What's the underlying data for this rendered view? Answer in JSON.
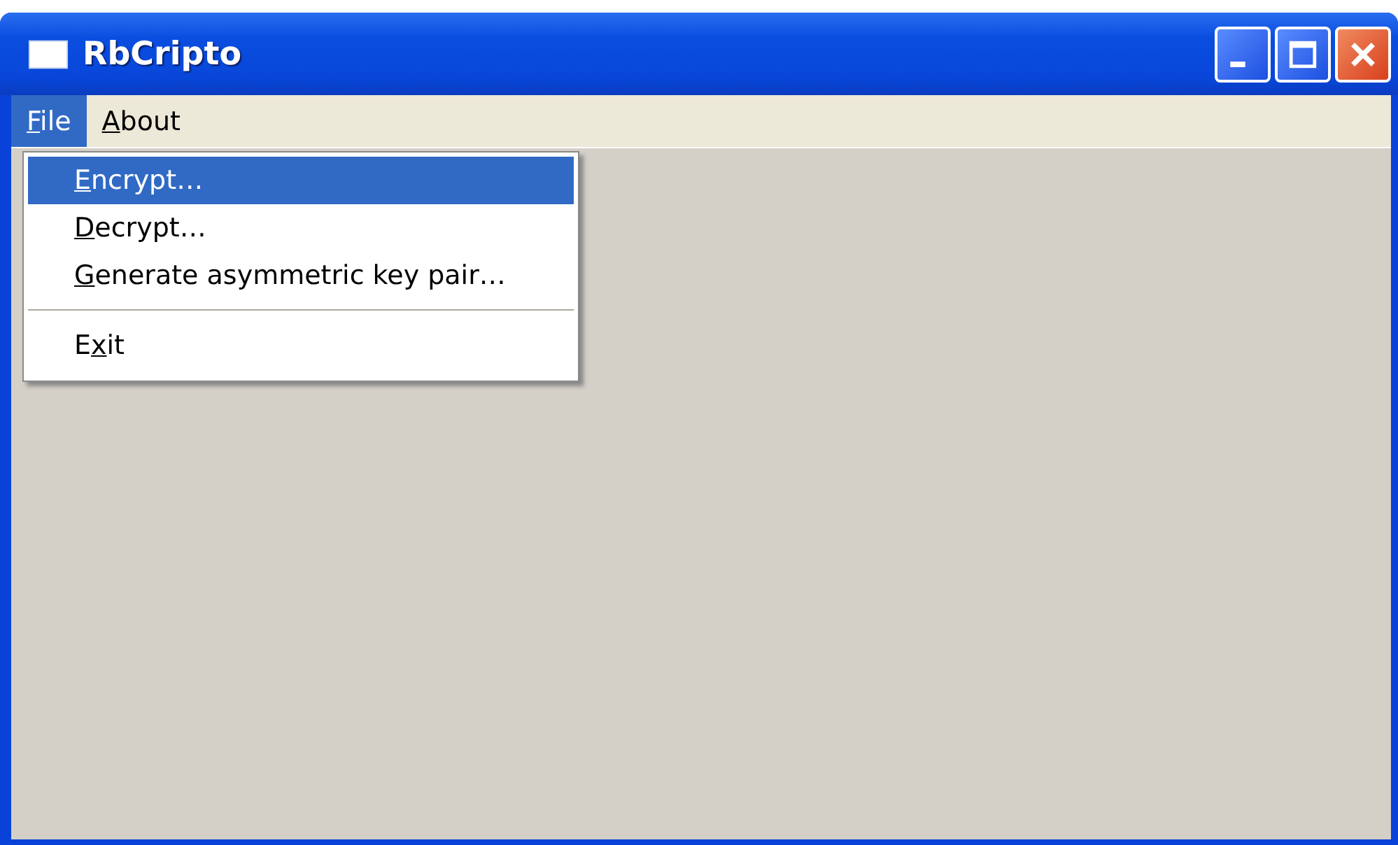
{
  "window": {
    "title": "RbCripto"
  },
  "menu_bar": [
    {
      "key": "F",
      "post": "ile",
      "selected": true
    },
    {
      "key": "A",
      "post": "bout",
      "selected": false
    }
  ],
  "dropdown": [
    {
      "kind": "item",
      "key": "E",
      "post": "ncrypt…",
      "selected": true
    },
    {
      "kind": "item",
      "key": "D",
      "post": "ecrypt…",
      "selected": false
    },
    {
      "kind": "item",
      "key": "G",
      "post": "enerate asymmetric key pair…",
      "selected": false
    },
    {
      "kind": "separator"
    },
    {
      "kind": "item",
      "pre": "E",
      "key": "x",
      "post": "it",
      "selected": false
    }
  ]
}
